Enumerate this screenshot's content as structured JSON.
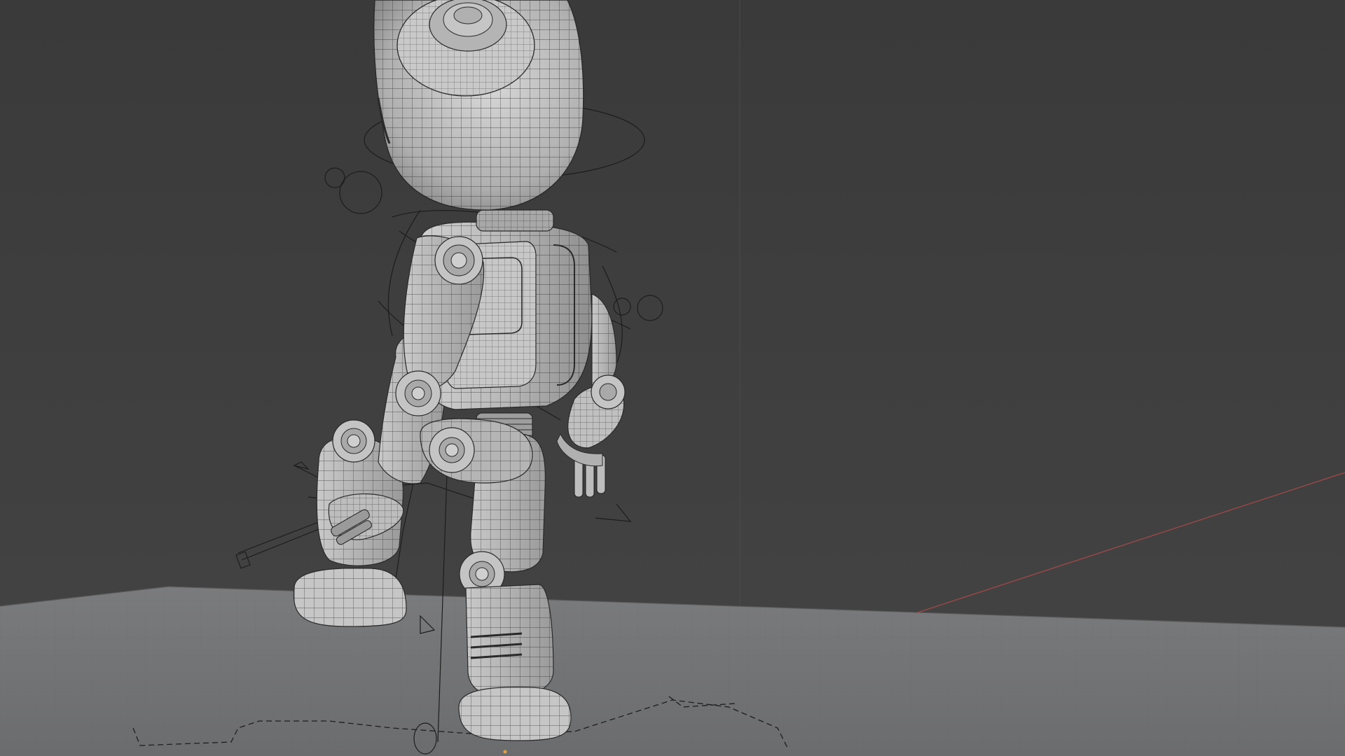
{
  "viewport": {
    "mode": "wireframe-overlay-solid",
    "background_color": "#3d3d3d",
    "floor_color": "#6f7072",
    "mesh_color": "#b9b9b9",
    "wire_color": "#2a2a2a",
    "x_axis_color": "#b04a4a",
    "object_origin_color": "#e0a040",
    "subject": "robot-character-rig"
  }
}
